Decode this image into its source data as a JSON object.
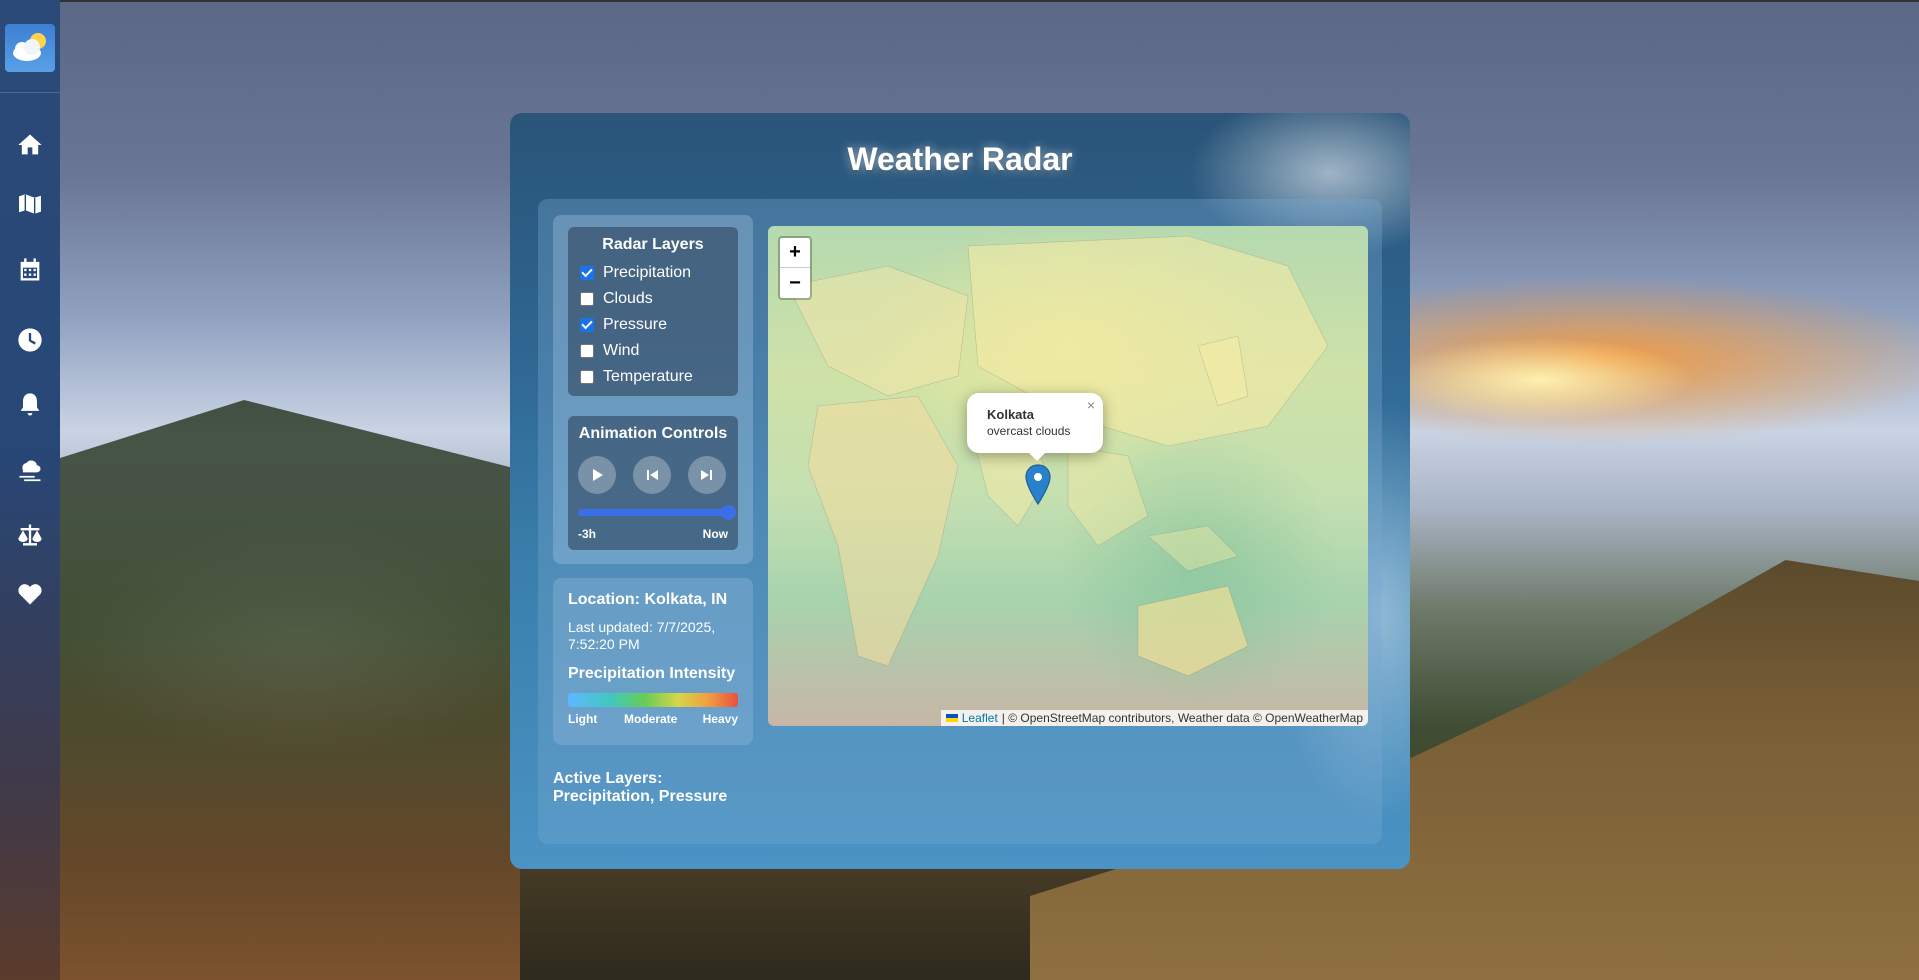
{
  "panel": {
    "title": "Weather Radar"
  },
  "radar_layers": {
    "title": "Radar Layers",
    "items": [
      {
        "label": "Precipitation",
        "checked": true
      },
      {
        "label": "Clouds",
        "checked": false
      },
      {
        "label": "Pressure",
        "checked": true
      },
      {
        "label": "Wind",
        "checked": false
      },
      {
        "label": "Temperature",
        "checked": false
      }
    ]
  },
  "animation": {
    "title": "Animation Controls",
    "buttons": [
      "play-icon",
      "skip-back-icon",
      "skip-forward-icon"
    ],
    "slider_value": 1.0,
    "start_label": "-3h",
    "end_label": "Now"
  },
  "info": {
    "location": "Location: Kolkata, IN",
    "updated": "Last updated: 7/7/2025, 7:52:20 PM",
    "intensity_title": "Precipitation Intensity",
    "intensity_labels": [
      "Light",
      "Moderate",
      "Heavy"
    ]
  },
  "active_layers": {
    "label": "Active Layers:",
    "value": "Precipitation, Pressure"
  },
  "map": {
    "zoom_in": "+",
    "zoom_out": "−",
    "popup": {
      "close": "×",
      "city": "Kolkata",
      "description": "overcast clouds"
    },
    "attribution": {
      "link": "Leaflet",
      "text": "| © OpenStreetMap contributors, Weather data © OpenWeatherMap"
    }
  },
  "colors": {
    "accent": "#3b6fe8",
    "marker": "#2a81cb"
  },
  "sidebar": {
    "items": [
      "home-icon",
      "map-icon",
      "calendar-icon",
      "clock-icon",
      "bell-icon",
      "weather-cloud-icon",
      "compare-scale-icon",
      "heart-icon"
    ]
  }
}
